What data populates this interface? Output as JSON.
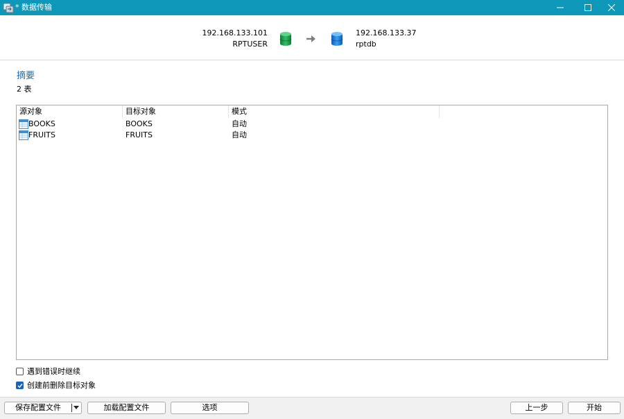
{
  "window": {
    "title": "* 数据传输"
  },
  "source": {
    "host": "192.168.133.101",
    "name": "RPTUSER",
    "icon": "green-database-icon",
    "color": "#1f9d4b"
  },
  "target": {
    "host": "192.168.133.37",
    "name": "rptdb",
    "icon": "blue-database-icon",
    "color": "#1f7ad6"
  },
  "summary": {
    "title": "摘要",
    "count": "2 表"
  },
  "grid": {
    "columns": [
      "源对象",
      "目标对象",
      "模式"
    ],
    "rows": [
      {
        "source": "BOOKS",
        "target": "BOOKS",
        "mode": "自动"
      },
      {
        "source": "FRUITS",
        "target": "FRUITS",
        "mode": "自动"
      }
    ]
  },
  "options": {
    "continue_on_error": {
      "label": "遇到错误时继续",
      "checked": false
    },
    "drop_before_create": {
      "label": "创建前删除目标对象",
      "checked": true
    }
  },
  "footer": {
    "save_profile": "保存配置文件",
    "load_profile": "加载配置文件",
    "options": "选项",
    "back": "上一步",
    "start": "开始"
  },
  "colors": {
    "titlebar": "#0e97b9",
    "accent": "#1a6fb5",
    "checkbox": "#1565c0"
  }
}
